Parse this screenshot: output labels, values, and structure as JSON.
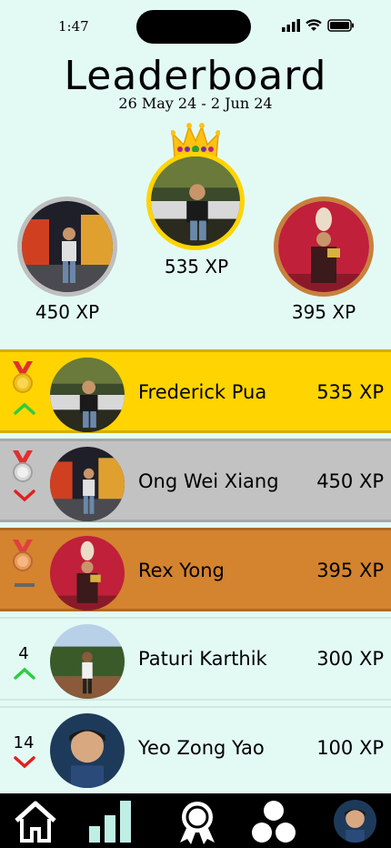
{
  "status": {
    "time": "1:47"
  },
  "header": {
    "title": "Leaderboard",
    "dates": "26 May 24 - 2 Jun 24"
  },
  "podium": {
    "first": {
      "xp": "535 XP"
    },
    "second": {
      "xp": "450 XP"
    },
    "third": {
      "xp": "395 XP"
    }
  },
  "list": [
    {
      "name": "Frederick Pua",
      "xp": "535 XP",
      "rank": "",
      "trend": "up",
      "medal": "gold"
    },
    {
      "name": "Ong Wei Xiang",
      "xp": "450 XP",
      "rank": "",
      "trend": "down",
      "medal": "silver"
    },
    {
      "name": "Rex Yong",
      "xp": "395 XP",
      "rank": "",
      "trend": "same",
      "medal": "bronze"
    },
    {
      "name": "Paturi Karthik",
      "xp": "300 XP",
      "rank": "4",
      "trend": "up"
    },
    {
      "name": "Yeo Zong Yao",
      "xp": "100 XP",
      "rank": "14",
      "trend": "down"
    }
  ],
  "colors": {
    "background": "#e3faf4",
    "gold": "#ffd400",
    "silver": "#c0c0c0",
    "bronze": "#d4832e",
    "up": "#2ecc40",
    "down": "#e02020"
  },
  "nav": {
    "items": [
      "home-icon",
      "stats-icon",
      "badge-icon",
      "community-icon",
      "profile-avatar"
    ]
  }
}
